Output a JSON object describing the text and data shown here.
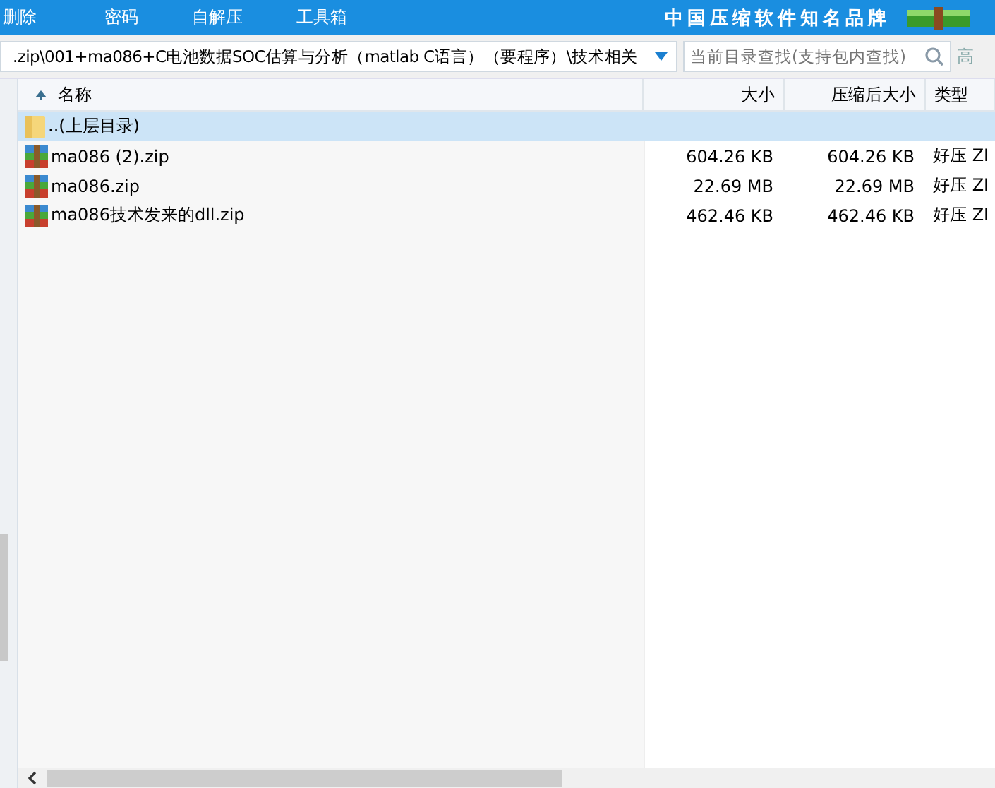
{
  "menu": [
    "删除",
    "密码",
    "自解压",
    "工具箱"
  ],
  "slogan": "中国压缩软件知名品牌",
  "address": {
    "value": ".zip\\001+ma086+C电池数据SOC估算与分析（matlab C语言）（要程序）\\技术相关"
  },
  "search": {
    "placeholder": "当前目录查找(支持包内查找)",
    "advanced": "高"
  },
  "table": {
    "columns": [
      {
        "label": "名称",
        "sorted": true
      },
      {
        "label": "大小",
        "sorted": false
      },
      {
        "label": "压缩后大小",
        "sorted": false
      },
      {
        "label": "类型",
        "sorted": false
      }
    ],
    "rows": [
      {
        "kind": "folder",
        "name": "..(上层目录)",
        "selected": true
      },
      {
        "kind": "archive",
        "name": "ma086 (2).zip",
        "size": "604.26 KB",
        "packed": "604.26 KB",
        "type": "好压 ZI",
        "selected": false
      },
      {
        "kind": "archive",
        "name": "ma086.zip",
        "size": "22.69 MB",
        "packed": "22.69 MB",
        "type": "好压 ZI",
        "selected": false
      },
      {
        "kind": "archive",
        "name": "ma086技术发来的dll.zip",
        "size": "462.46 KB",
        "packed": "462.46 KB",
        "type": "好压 ZI",
        "selected": false
      }
    ]
  }
}
